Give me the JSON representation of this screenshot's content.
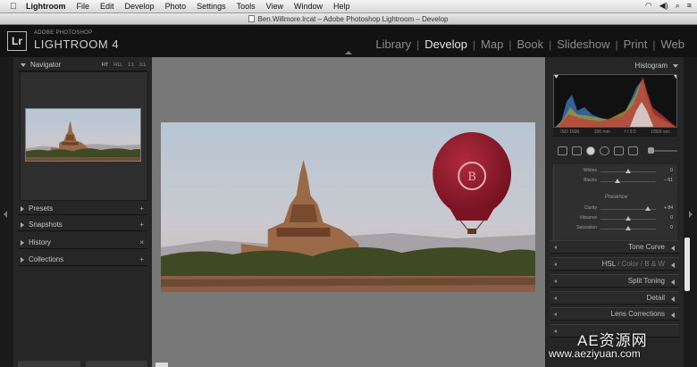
{
  "menubar": {
    "app_name": "Lightroom",
    "items": [
      "File",
      "Edit",
      "Develop",
      "Photo",
      "Settings",
      "Tools",
      "View",
      "Window",
      "Help"
    ]
  },
  "window": {
    "title": "Ben.Willmore.lrcat – Adobe Photoshop Lightroom – Develop"
  },
  "header": {
    "badge": "Lr",
    "brand_small": "ADOBE PHOTOSHOP",
    "brand_big": "LIGHTROOM 4",
    "modules": [
      "Library",
      "Develop",
      "Map",
      "Book",
      "Slideshow",
      "Print",
      "Web"
    ],
    "active_module": "Develop"
  },
  "left_panel": {
    "navigator": {
      "title": "Navigator",
      "zoom_options": [
        "FIT",
        "FILL",
        "1:1",
        "3:1"
      ],
      "active_zoom": "FIT"
    },
    "panels": [
      {
        "label": "Presets",
        "action": "+"
      },
      {
        "label": "Snapshots",
        "action": "+"
      },
      {
        "label": "History",
        "action": "×"
      },
      {
        "label": "Collections",
        "action": "+"
      }
    ]
  },
  "right_panel": {
    "histogram": {
      "title": "Histogram",
      "exif": [
        "ISO 1600",
        "100 mm",
        "f / 9.5",
        "1/800 sec"
      ]
    },
    "basic": {
      "sliders_top": [
        {
          "label": "Whites",
          "value": "0",
          "pos": 0.5
        },
        {
          "label": "Blacks",
          "value": "– 61",
          "pos": 0.3
        }
      ],
      "presence_label": "Presence",
      "sliders_presence": [
        {
          "label": "Clarity",
          "value": "+ 84",
          "pos": 0.86
        },
        {
          "label": "Vibrance",
          "value": "0",
          "pos": 0.5
        },
        {
          "label": "Saturation",
          "value": "0",
          "pos": 0.5
        }
      ]
    },
    "sections": [
      {
        "label": "Tone Curve"
      },
      {
        "label": "HSL",
        "extras": [
          " / ",
          "Color",
          " / ",
          "B & W"
        ]
      },
      {
        "label": "Split Toning"
      },
      {
        "label": "Detail"
      },
      {
        "label": "Lens Corrections"
      }
    ]
  },
  "watermark": {
    "line1": "AE资源网",
    "line2": "www.aeziyuan.com"
  },
  "colors": {
    "panel_bg": "#262626",
    "canvas_bg": "#787878",
    "header_bg": "#121212",
    "balloon": "#8b1a2a"
  }
}
